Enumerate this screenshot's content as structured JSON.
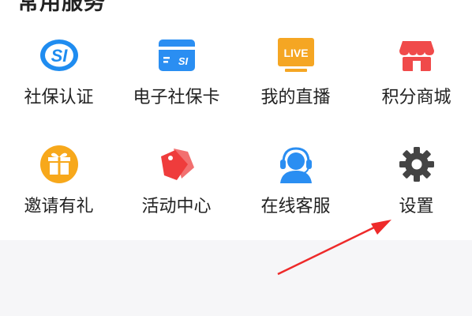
{
  "section": {
    "title": "常用服务"
  },
  "services": [
    {
      "label": "社保认证",
      "icon": "social-security-icon",
      "color": "#1f8cf0"
    },
    {
      "label": "电子社保卡",
      "icon": "e-social-security-card-icon",
      "color": "#2a8ef2"
    },
    {
      "label": "我的直播",
      "icon": "live-tv-icon",
      "color": "#f5a623",
      "badge": "LIVE"
    },
    {
      "label": "积分商城",
      "icon": "store-icon",
      "color": "#f04a4a"
    },
    {
      "label": "邀请有礼",
      "icon": "gift-icon",
      "color": "#f7a81b"
    },
    {
      "label": "活动中心",
      "icon": "price-tag-icon",
      "color": "#ef3c3c"
    },
    {
      "label": "在线客服",
      "icon": "customer-service-icon",
      "color": "#2a8ef2"
    },
    {
      "label": "设置",
      "icon": "gear-icon",
      "color": "#444444"
    }
  ],
  "icon_text": {
    "social_security": "SI",
    "card": "SI",
    "live": "LIVE"
  },
  "annotation": {
    "color": "#ee2a2a"
  }
}
